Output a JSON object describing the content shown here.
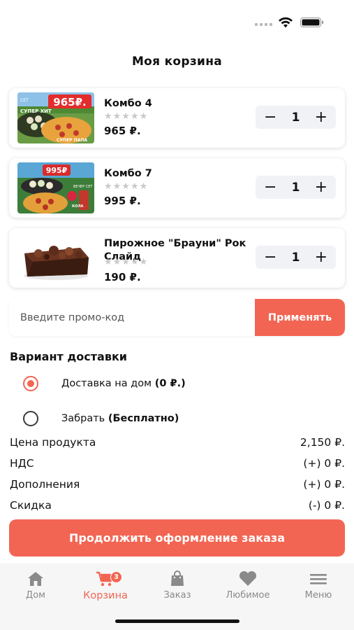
{
  "page": {
    "title": "Моя корзина"
  },
  "cart": {
    "items": [
      {
        "name": "Комбо 4",
        "stars": "★★★★★",
        "price": "965 ₽.",
        "quantity": "1",
        "minus": "−",
        "plus": "+",
        "thumb_text": {
          "price": "965₽.",
          "set": "СЕТ",
          "super": "СУПЕР ХИТ",
          "tag": "СУПЕР ПАПА"
        }
      },
      {
        "name": "Комбо 7",
        "stars": "★★★★★",
        "price": "995 ₽.",
        "quantity": "1",
        "minus": "−",
        "plus": "+",
        "thumb_text": {
          "price": "995₽",
          "set": "ВЕЧЕР СЕТ",
          "drink": "КОЛА"
        }
      },
      {
        "name": "Пирожное \"Брауни\" Рок Слайд",
        "stars": "★★★★★",
        "price": "190 ₽.",
        "quantity": "1",
        "minus": "−",
        "plus": "+"
      }
    ]
  },
  "promo": {
    "placeholder": "Введите промо-код",
    "apply_label": "Применять"
  },
  "delivery": {
    "title": "Вариант доставки",
    "options": [
      {
        "label": "Доставка на дом",
        "note": "(0 ₽.)",
        "selected": true
      },
      {
        "label": "Забрать",
        "note": "(Бесплатно)",
        "selected": false
      }
    ]
  },
  "summary": [
    {
      "label": "Цена продукта",
      "value": "2,150 ₽."
    },
    {
      "label": "НДС",
      "value": "(+) 0 ₽."
    },
    {
      "label": "Дополнения",
      "value": "(+) 0 ₽."
    },
    {
      "label": "Скидка",
      "value": "(-) 0 ₽."
    }
  ],
  "checkout_label": "Продолжить оформление заказа",
  "tabbar": {
    "items": [
      {
        "label": "Дом",
        "icon": "home-icon"
      },
      {
        "label": "Корзина",
        "icon": "cart-icon",
        "badge": "3",
        "active": true
      },
      {
        "label": "Заказ",
        "icon": "bag-icon"
      },
      {
        "label": "Любимое",
        "icon": "heart-icon"
      },
      {
        "label": "Меню",
        "icon": "menu-icon"
      }
    ]
  },
  "colors": {
    "accent": "#f26552",
    "inactive": "#8a8a8a",
    "stepper_bg": "#f1f2f6"
  }
}
